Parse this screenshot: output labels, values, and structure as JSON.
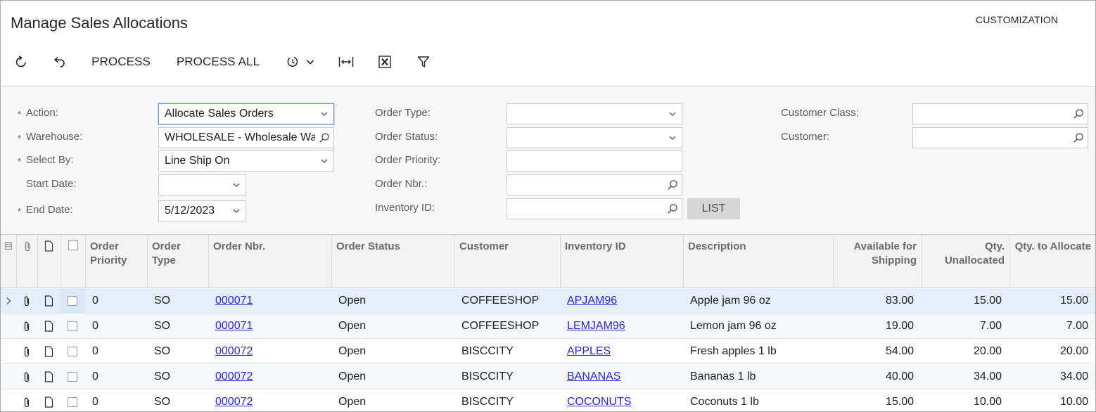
{
  "page": {
    "title": "Manage Sales Allocations",
    "customization_label": "CUSTOMIZATION"
  },
  "toolbar": {
    "refresh_icon": "refresh-icon",
    "undo_icon": "undo-icon",
    "process_label": "PROCESS",
    "process_all_label": "PROCESS ALL",
    "schedule_icon": "schedule-icon",
    "fit_columns_icon": "fit-columns-icon",
    "export_excel_icon": "excel-icon",
    "filter_icon": "filter-icon"
  },
  "filters": {
    "action": {
      "label": "Action:",
      "value": "Allocate Sales Orders",
      "required": true
    },
    "warehouse": {
      "label": "Warehouse:",
      "value": "WHOLESALE - Wholesale Wa",
      "required": true
    },
    "select_by": {
      "label": "Select By:",
      "value": "Line Ship On",
      "required": true
    },
    "start_date": {
      "label": "Start Date:",
      "value": ""
    },
    "end_date": {
      "label": "End Date:",
      "value": "5/12/2023",
      "required": true
    },
    "order_type": {
      "label": "Order Type:",
      "value": ""
    },
    "order_status": {
      "label": "Order Status:",
      "value": ""
    },
    "order_priority": {
      "label": "Order Priority:",
      "value": ""
    },
    "order_nbr": {
      "label": "Order Nbr.:",
      "value": ""
    },
    "inventory_id": {
      "label": "Inventory ID:",
      "value": ""
    },
    "customer_class": {
      "label": "Customer Class:",
      "value": ""
    },
    "customer": {
      "label": "Customer:",
      "value": ""
    },
    "list_button": "LIST",
    "required_marker": "*"
  },
  "grid": {
    "columns": {
      "order_priority": "Order Priority",
      "order_type": "Order Type",
      "order_nbr": "Order Nbr.",
      "order_status": "Order Status",
      "customer": "Customer",
      "inventory_id": "Inventory ID",
      "description": "Description",
      "available": "Available for Shipping",
      "qty_unallocated": "Qty. Unallocated",
      "qty_to_allocate": "Qty. to Allocate"
    },
    "rows": [
      {
        "priority": "0",
        "type": "SO",
        "order_nbr": "000071",
        "status": "Open",
        "customer": "COFFEESHOP",
        "inventory_id": "APJAM96",
        "description": "Apple jam 96 oz",
        "available": "83.00",
        "unallocated": "15.00",
        "to_allocate": "15.00"
      },
      {
        "priority": "0",
        "type": "SO",
        "order_nbr": "000071",
        "status": "Open",
        "customer": "COFFEESHOP",
        "inventory_id": "LEMJAM96",
        "description": "Lemon jam 96 oz",
        "available": "19.00",
        "unallocated": "7.00",
        "to_allocate": "7.00"
      },
      {
        "priority": "0",
        "type": "SO",
        "order_nbr": "000072",
        "status": "Open",
        "customer": "BISCCITY",
        "inventory_id": "APPLES",
        "description": "Fresh apples 1 lb",
        "available": "54.00",
        "unallocated": "20.00",
        "to_allocate": "20.00"
      },
      {
        "priority": "0",
        "type": "SO",
        "order_nbr": "000072",
        "status": "Open",
        "customer": "BISCCITY",
        "inventory_id": "BANANAS",
        "description": "Bananas 1 lb",
        "available": "40.00",
        "unallocated": "34.00",
        "to_allocate": "34.00"
      },
      {
        "priority": "0",
        "type": "SO",
        "order_nbr": "000072",
        "status": "Open",
        "customer": "BISCCITY",
        "inventory_id": "COCONUTS",
        "description": "Coconuts 1 lb",
        "available": "15.00",
        "unallocated": "10.00",
        "to_allocate": "10.00"
      }
    ]
  }
}
